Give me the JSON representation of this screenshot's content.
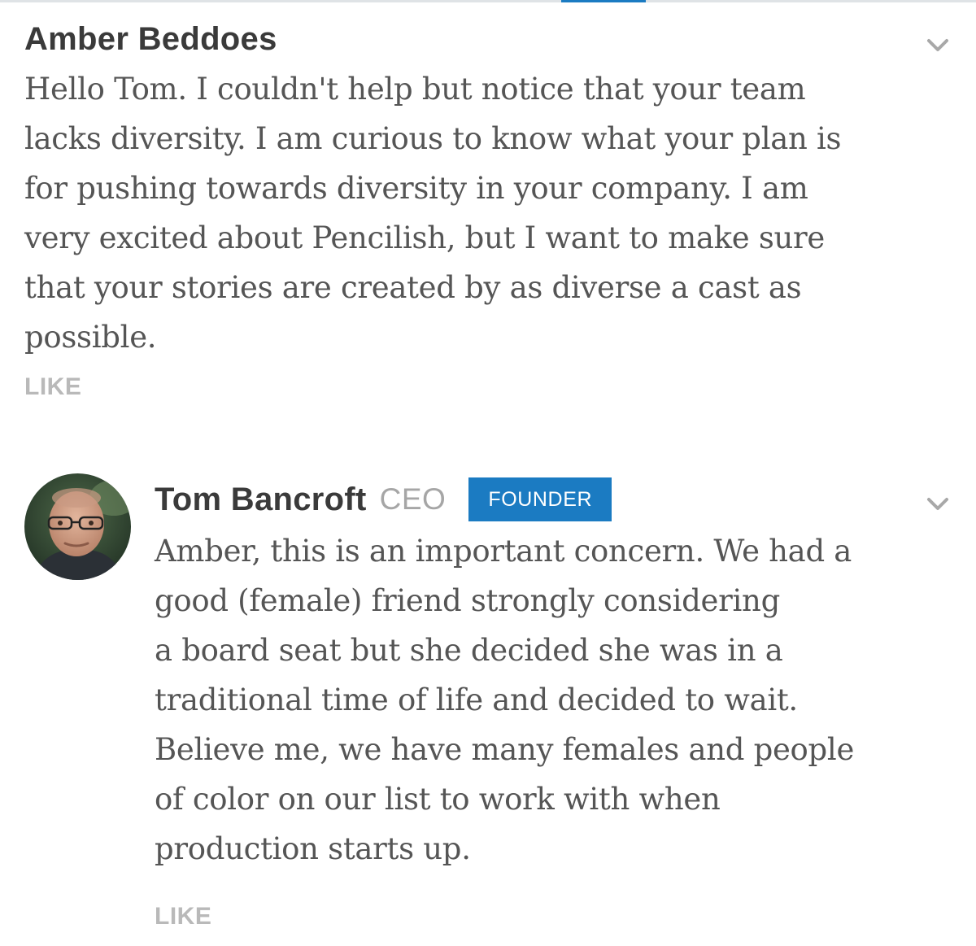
{
  "comments": [
    {
      "author": "Amber Beddoes",
      "text_lines": [
        "Hello Tom. I couldn't help but notice that your team",
        "lacks diversity. I am curious to know what your plan is",
        "for pushing towards diversity in your company. I am",
        "very excited about Pencilish, but I want to make sure",
        "that your stories are created by as diverse a cast as",
        "possible."
      ],
      "like_label": "LIKE",
      "menu_icon": "chevron-down-icon"
    },
    {
      "author": "Tom Bancroft",
      "role": "CEO",
      "badge": "FOUNDER",
      "avatar_icon": "avatar",
      "text_lines": [
        "Amber, this is an important concern. We had a",
        "good (female) friend strongly considering",
        "a board seat but she decided she was in a",
        "traditional time of life and decided to wait.",
        "Believe me, we have many females and  people",
        "of color on our list to work with when",
        "production starts up."
      ],
      "like_label": "LIKE",
      "menu_icon": "chevron-down-icon"
    }
  ],
  "colors": {
    "accent": "#1b7bc2",
    "author_text": "#3a3a3a",
    "body_text": "#555555",
    "muted": "#b9b9b9"
  }
}
